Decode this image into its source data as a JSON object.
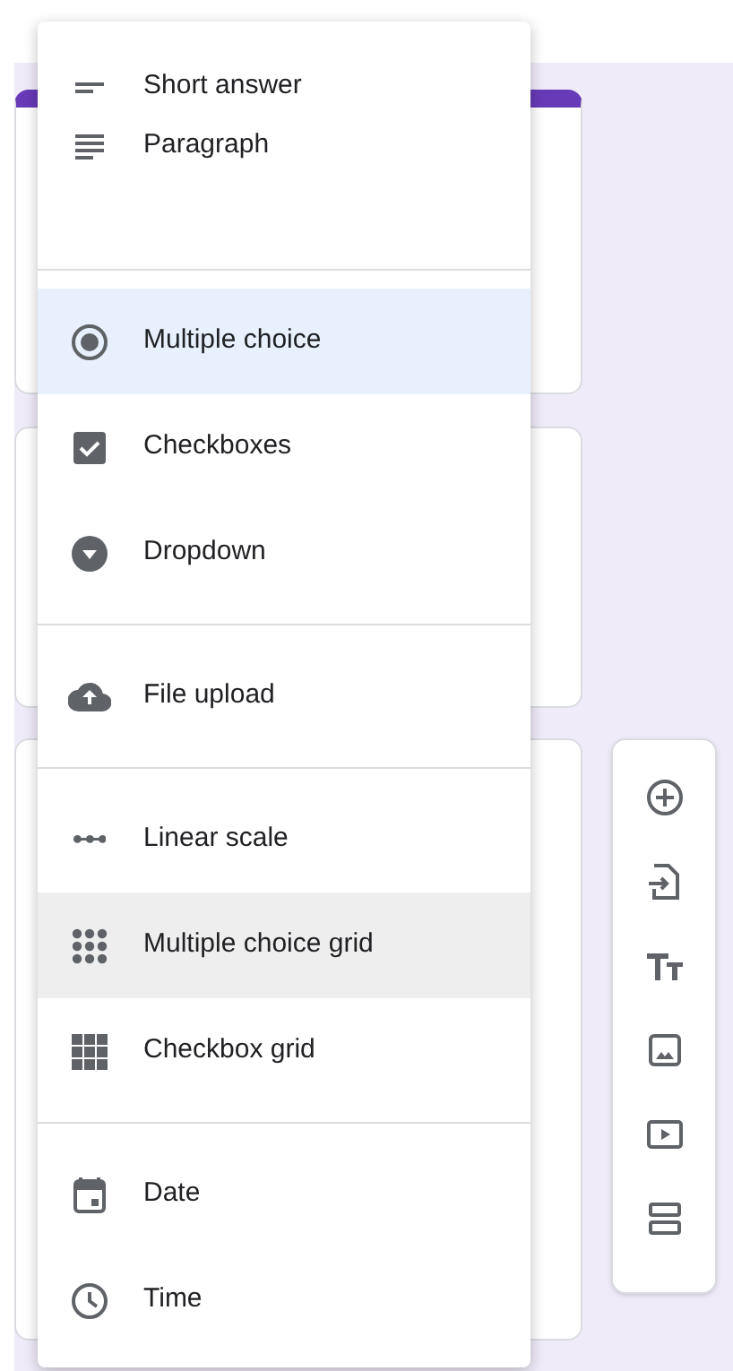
{
  "question_type_menu": {
    "groups": [
      {
        "items": [
          {
            "label": "Short answer",
            "kind": "short",
            "selected": false,
            "hovered": false
          },
          {
            "label": "Paragraph",
            "kind": "paragraph",
            "selected": false,
            "hovered": false
          }
        ]
      },
      {
        "items": [
          {
            "label": "Multiple choice",
            "kind": "radio",
            "selected": true,
            "hovered": false
          },
          {
            "label": "Checkboxes",
            "kind": "checkbox",
            "selected": false,
            "hovered": false
          },
          {
            "label": "Dropdown",
            "kind": "dropdown",
            "selected": false,
            "hovered": false
          }
        ]
      },
      {
        "items": [
          {
            "label": "File upload",
            "kind": "upload",
            "selected": false,
            "hovered": false
          }
        ]
      },
      {
        "items": [
          {
            "label": "Linear scale",
            "kind": "scale",
            "selected": false,
            "hovered": false
          },
          {
            "label": "Multiple choice grid",
            "kind": "dotgrid",
            "selected": false,
            "hovered": true
          },
          {
            "label": "Checkbox grid",
            "kind": "boxgrid",
            "selected": false,
            "hovered": false
          }
        ]
      },
      {
        "items": [
          {
            "label": "Date",
            "kind": "date",
            "selected": false,
            "hovered": false
          },
          {
            "label": "Time",
            "kind": "time",
            "selected": false,
            "hovered": false
          }
        ]
      }
    ]
  }
}
